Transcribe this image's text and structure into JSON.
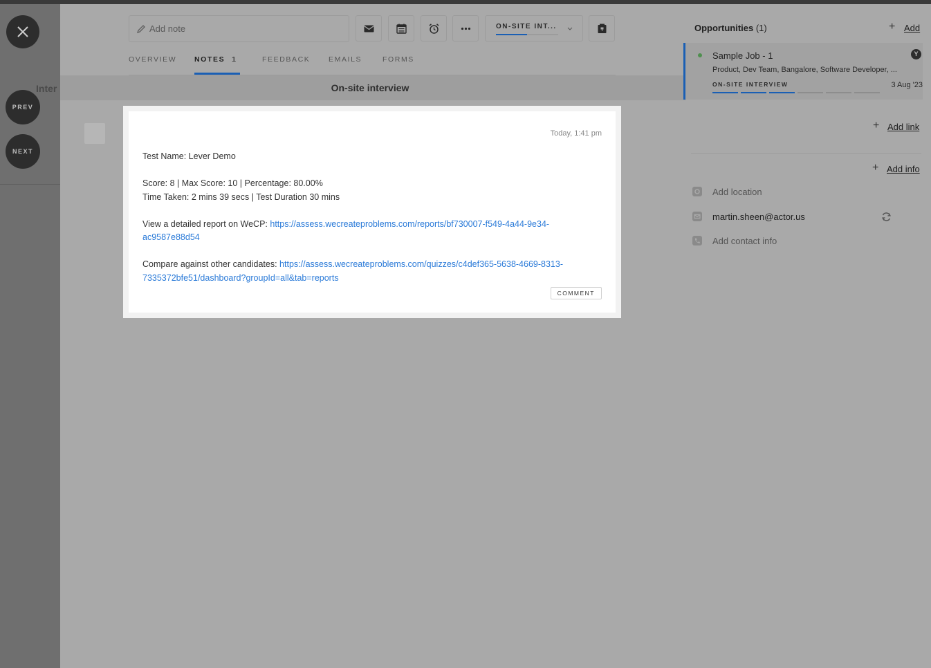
{
  "nav": {
    "prev_label": "PREV",
    "next_label": "NEXT"
  },
  "background": {
    "side_heading": "Inter"
  },
  "toolbar": {
    "note_placeholder": "Add note",
    "stage_label": "ON-SITE INT...",
    "stage_progress": 0.5,
    "icons": [
      "mail-icon",
      "calendar-icon",
      "alarm-clock-icon",
      "more-icon",
      "archive-icon"
    ]
  },
  "tabs": [
    {
      "label": "OVERVIEW"
    },
    {
      "label": "NOTES",
      "count": "1",
      "active": true
    },
    {
      "label": "FEEDBACK"
    },
    {
      "label": "EMAILS"
    },
    {
      "label": "FORMS"
    }
  ],
  "stage_header": "On-site interview",
  "right_panel": {
    "title": "Opportunities",
    "count": "(1)",
    "add_label": "Add",
    "opportunity": {
      "title": "Sample Job - 1",
      "subtitle": "Product, Dev Team, Bangalore, Software Developer, ...",
      "stage": "ON-SITE INTERVIEW",
      "date": "3 Aug '23",
      "avatar_initial": "Y",
      "progress_completed": 3,
      "progress_total": 6
    },
    "add_link_label": "Add link",
    "add_info_label": "Add info",
    "location_placeholder": "Add location",
    "email": "martin.sheen@actor.us",
    "contact_placeholder": "Add contact info"
  },
  "note": {
    "timestamp": "Today, 1:41 pm",
    "test_name": "Test Name: Lever Demo",
    "score_line": "Score: 8 | Max Score: 10 | Percentage: 80.00%",
    "time_line": "Time Taken: 2 mins 39 secs | Test Duration 30 mins",
    "report_prefix": "View a detailed report on WeCP: ",
    "report_url_1": "https://assess.wecreateproblems.com/reports/bf730007-f549-4a44-9e34-",
    "report_url_2": "ac9587e88d54",
    "compare_prefix": "Compare against other candidates: ",
    "compare_url_1": "https://assess.wecreateproblems.com/quizzes/c4def365-5638-4669-8313-",
    "compare_url_2": "7335372bfe51/dashboard?groupId=all&tab=reports",
    "comment_label": "COMMENT"
  }
}
